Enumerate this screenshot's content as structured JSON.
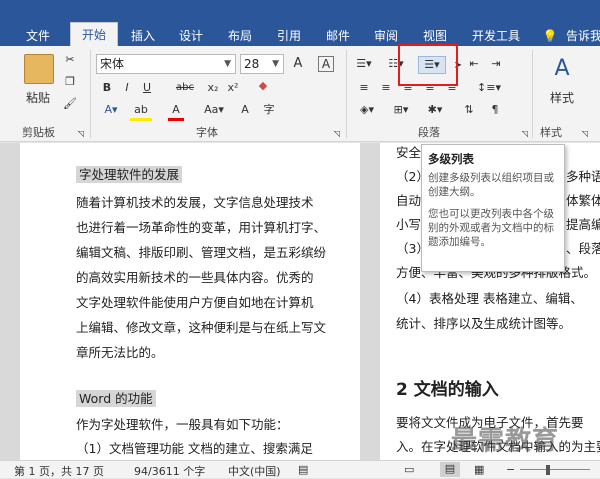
{
  "tabs": [
    "文件",
    "开始",
    "插入",
    "设计",
    "布局",
    "引用",
    "邮件",
    "审阅",
    "视图",
    "开发工具"
  ],
  "tell_me": "告诉我",
  "clipboard": {
    "paste": "粘贴",
    "label": "剪贴板"
  },
  "font": {
    "name": "宋体",
    "size": "28",
    "label": "字体"
  },
  "paragraph": {
    "label": "段落"
  },
  "styles": {
    "button": "样式",
    "label": "样式"
  },
  "tooltip": {
    "title": "多级列表",
    "desc1": "创建多级列表以组织项目或创建大纲。",
    "desc2": "您也可以更改列表中各个级别的外观或者为文档中的标题添加编号。"
  },
  "left_page": {
    "heading": "字处理软件的发展",
    "para1": [
      "随着计算机技术的发展，文字信息处理技术",
      "也进行着一场革命性的变革，用计算机打字、",
      "编辑文稿、排版印刷、管理文档，是五彩缤纷",
      "的高效实用新技术的一些具体内容。优秀的",
      "文字处理软件能使用户方便自如地在计算机",
      "上编辑、修改文章，这种便利是与在纸上写文",
      "章所无法比的。"
    ],
    "heading2": "Word 的功能",
    "para2": [
      "作为字处理软件，一般具有如下功能：",
      "（1）文档管理功能   文档的建立、搜索满足"
    ]
  },
  "right_page": {
    "lines_top": [
      "安全",
      "（2）",
      "自动",
      "小写",
      "（3）",
      "方便、丰富、美观的多种排版格式。"
    ],
    "lines_right": [
      "多种语",
      "体繁体",
      "提高编",
      "、段落"
    ],
    "table_line": "（4）表格处理   表格建立、编辑、",
    "table_line2": "统计、排序以及生成统计图等。",
    "heading": "2 文档的输入",
    "para": [
      "要将文文件成为电子文件，首先要",
      "入。在字处理软件文档中输入的为主要"
    ]
  },
  "status": {
    "page": "第 1 页，共 17 页",
    "words": "94/3611 个字",
    "lang": "中文(中国)"
  },
  "watermark": "最需教育",
  "colors": {
    "accent": "#2b579a",
    "highlight": "#d6d6d6",
    "red_box": "#e41c1c"
  }
}
